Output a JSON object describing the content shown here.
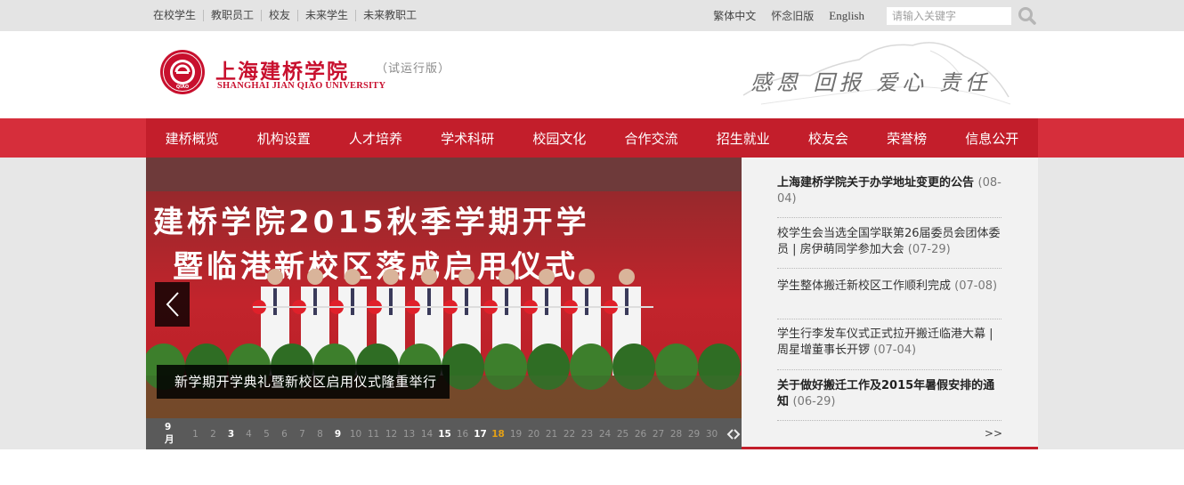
{
  "top_links": [
    "在校学生",
    "教职员工",
    "校友",
    "未来学生",
    "未来教职工"
  ],
  "top_right": {
    "traditional": "繁体中文",
    "old_version": "怀念旧版",
    "english": "English"
  },
  "search": {
    "placeholder": "请输入关键字"
  },
  "logo": {
    "seal_text": "QIAO",
    "cn": "上海建桥学院",
    "en": "SHANGHAI JIAN QIAO UNIVERSITY",
    "beta": "（试运行版）"
  },
  "motto": "感恩 回报 爱心 责任",
  "nav": [
    "建桥概览",
    "机构设置",
    "人才培养",
    "学术科研",
    "校园文化",
    "合作交流",
    "招生就业",
    "校友会",
    "荣誉榜",
    "信息公开"
  ],
  "slider": {
    "banner_line1": "建桥学院2015秋季学期开学",
    "banner_line2": "暨临港新校区落成启用仪式",
    "caption": "新学期开学典礼暨新校区启用仪式隆重举行",
    "month": "9月",
    "days": [
      "1",
      "2",
      "3",
      "4",
      "5",
      "6",
      "7",
      "8",
      "9",
      "10",
      "11",
      "12",
      "13",
      "14",
      "15",
      "16",
      "17",
      "18",
      "19",
      "20",
      "21",
      "22",
      "23",
      "24",
      "25",
      "26",
      "27",
      "28",
      "29",
      "30"
    ]
  },
  "news": [
    {
      "title": "上海建桥学院关于办学地址变更的公告",
      "date": "(08-04)",
      "bold": true
    },
    {
      "title": "校学生会当选全国学联第26届委员会团体委员 | 房伊萌同学参加大会",
      "date": "(07-29)",
      "bold": false
    },
    {
      "title": "学生整体搬迁新校区工作顺利完成",
      "date": "(07-08)",
      "bold": false
    },
    {
      "title": "学生行李发车仪式正式拉开搬迁临港大幕 | 周星增董事长开锣",
      "date": "(07-04)",
      "bold": false
    },
    {
      "title": "关于做好搬迁工作及2015年暑假安排的通知",
      "date": "(06-29)",
      "bold": true
    }
  ],
  "more": ">>",
  "colors": {
    "brand_red": "#c31e2b",
    "nav_outer": "#d62e3b",
    "today": "#e3a016"
  }
}
